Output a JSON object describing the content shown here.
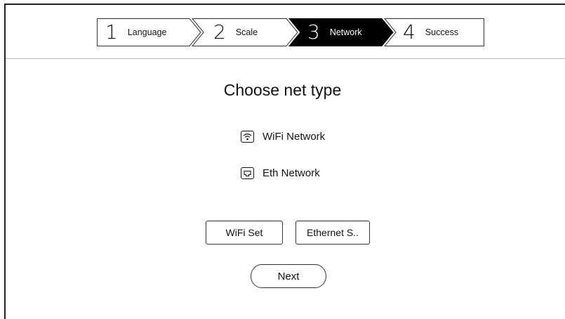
{
  "wizard": {
    "steps": [
      {
        "num": "1",
        "label": "Language"
      },
      {
        "num": "2",
        "label": "Scale"
      },
      {
        "num": "3",
        "label": "Network"
      },
      {
        "num": "4",
        "label": "Success"
      }
    ],
    "active_step_index": 2
  },
  "main": {
    "title": "Choose net type",
    "options": [
      {
        "label": "WiFi Network",
        "icon": "wifi-icon"
      },
      {
        "label": "Eth Network",
        "icon": "ethernet-port-icon"
      }
    ],
    "buttons": {
      "wifi_set": "WiFi Set",
      "ethernet_set": "Ethernet S..",
      "next": "Next"
    }
  },
  "colors": {
    "active_step_bg": "#000000",
    "active_step_text": "#ffffff",
    "divider": "#bdbdbd"
  }
}
